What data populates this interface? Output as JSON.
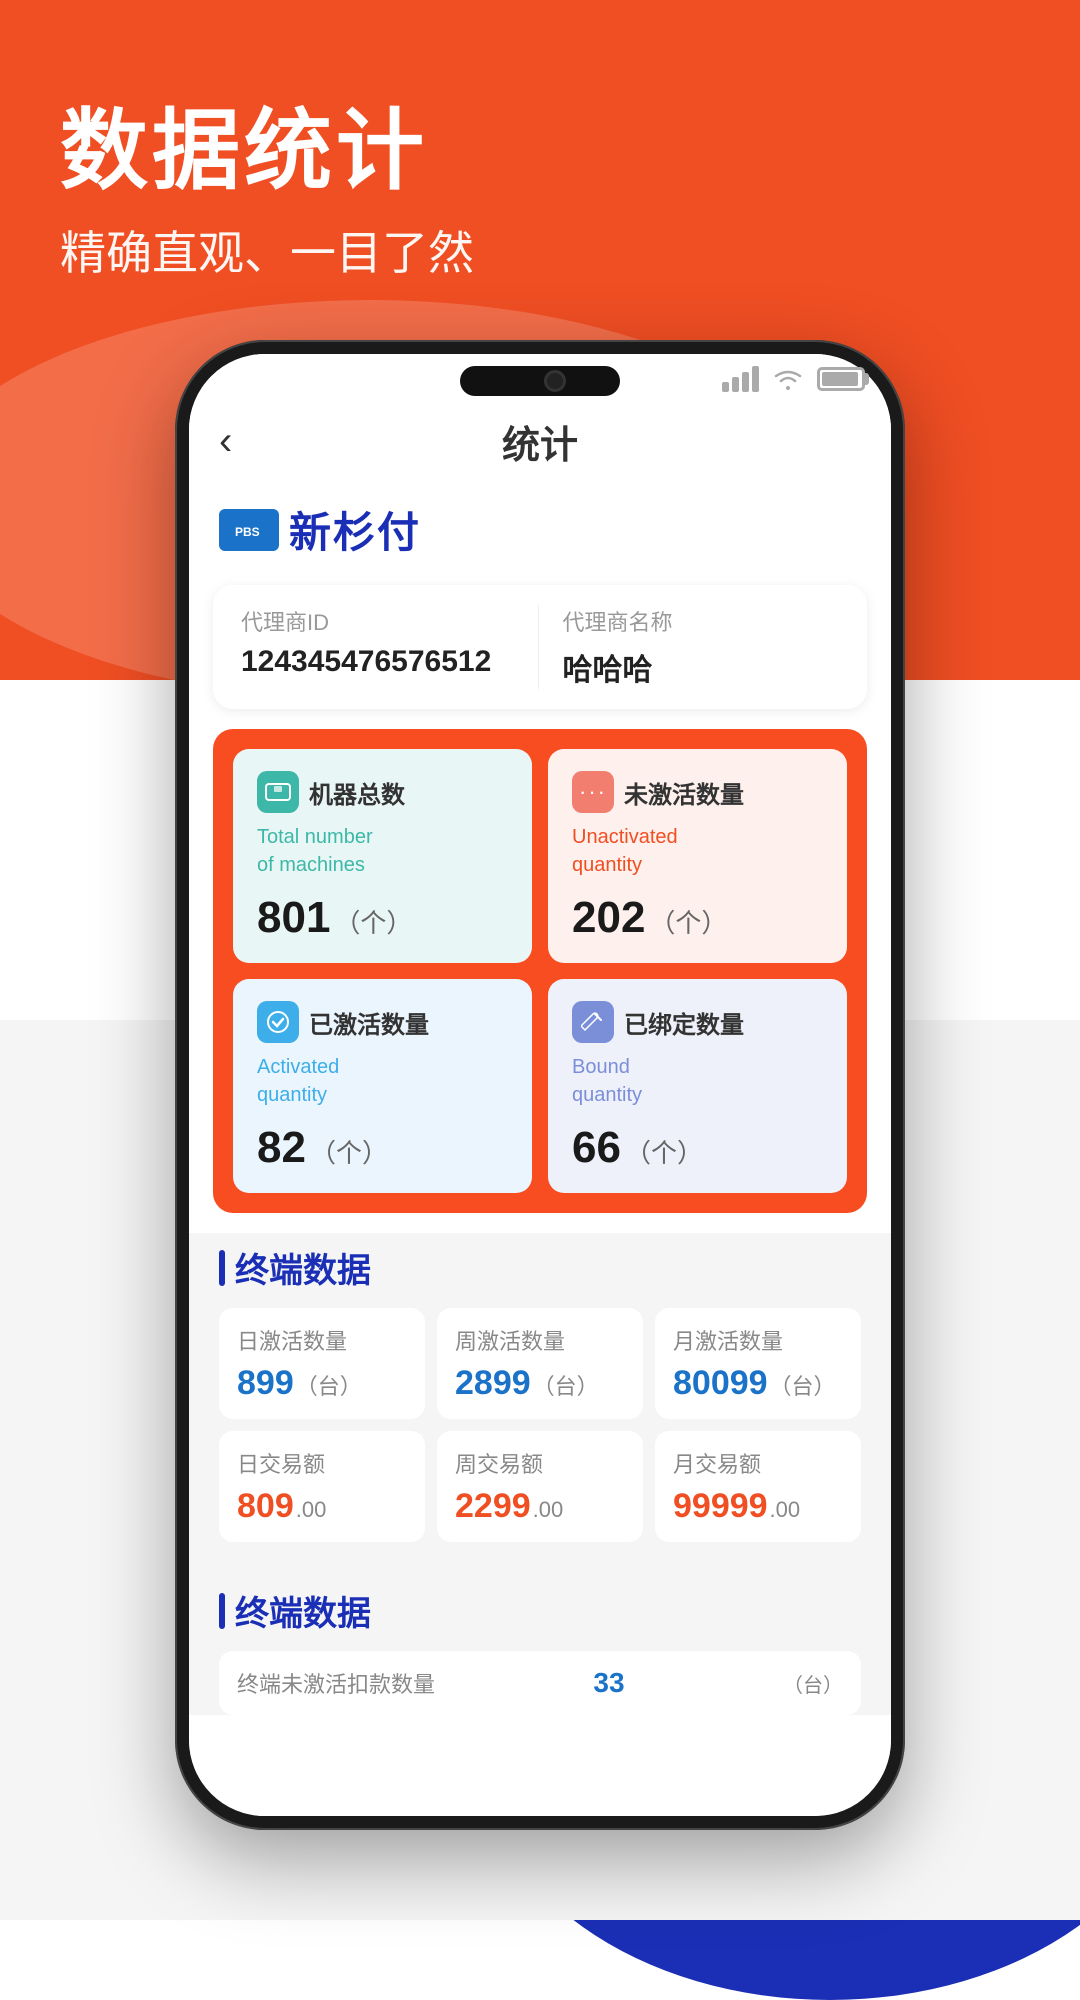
{
  "background": {
    "headerTitle": "数据统计",
    "headerSubtitle": "精确直观、一目了然"
  },
  "statusBar": {
    "signal": "signal-icon",
    "wifi": "wifi-icon",
    "battery": "battery-icon"
  },
  "topBar": {
    "backLabel": "‹",
    "title": "统计"
  },
  "logo": {
    "text": "新杉付"
  },
  "infoCard": {
    "agentIdLabel": "代理商ID",
    "agentIdValue": "124345476576512",
    "agentNameLabel": "代理商名称",
    "agentNameValue": "哈哈哈"
  },
  "statsCard": {
    "items": [
      {
        "name": "机器总数",
        "subEn": "Total number\nof machines",
        "value": "801",
        "unit": "（个）",
        "colorTheme": "teal",
        "iconText": "PBS"
      },
      {
        "name": "未激活数量",
        "subEn": "Unactivated\nquantity",
        "value": "202",
        "unit": "（个）",
        "colorTheme": "salmon",
        "iconText": "···"
      },
      {
        "name": "已激活数量",
        "subEn": "Activated\nquantity",
        "value": "82",
        "unit": "（个）",
        "colorTheme": "sky",
        "iconText": "✓"
      },
      {
        "name": "已绑定数量",
        "subEn": "Bound\nquantity",
        "value": "66",
        "unit": "（个）",
        "colorTheme": "lavender",
        "iconText": "✏"
      }
    ]
  },
  "terminalSection1": {
    "title": "终端数据",
    "rows": [
      [
        {
          "label": "日激活数量",
          "value": "899",
          "unit": "（台）",
          "colorClass": "blue"
        },
        {
          "label": "周激活数量",
          "value": "2899",
          "unit": "（台）",
          "colorClass": "blue"
        },
        {
          "label": "月激活数量",
          "value": "80099",
          "unit": "（台）",
          "colorClass": "blue"
        }
      ],
      [
        {
          "label": "日交易额",
          "value": "809",
          "unit": ".00",
          "colorClass": "orange"
        },
        {
          "label": "周交易额",
          "value": "2299",
          "unit": ".00",
          "colorClass": "orange"
        },
        {
          "label": "月交易额",
          "value": "99999",
          "unit": ".00",
          "colorClass": "orange"
        }
      ]
    ]
  },
  "terminalSection2": {
    "title": "终端数据",
    "previewLabel": "终端未激活扣款数量",
    "previewValue": "33",
    "previewUnit": "（台）"
  }
}
